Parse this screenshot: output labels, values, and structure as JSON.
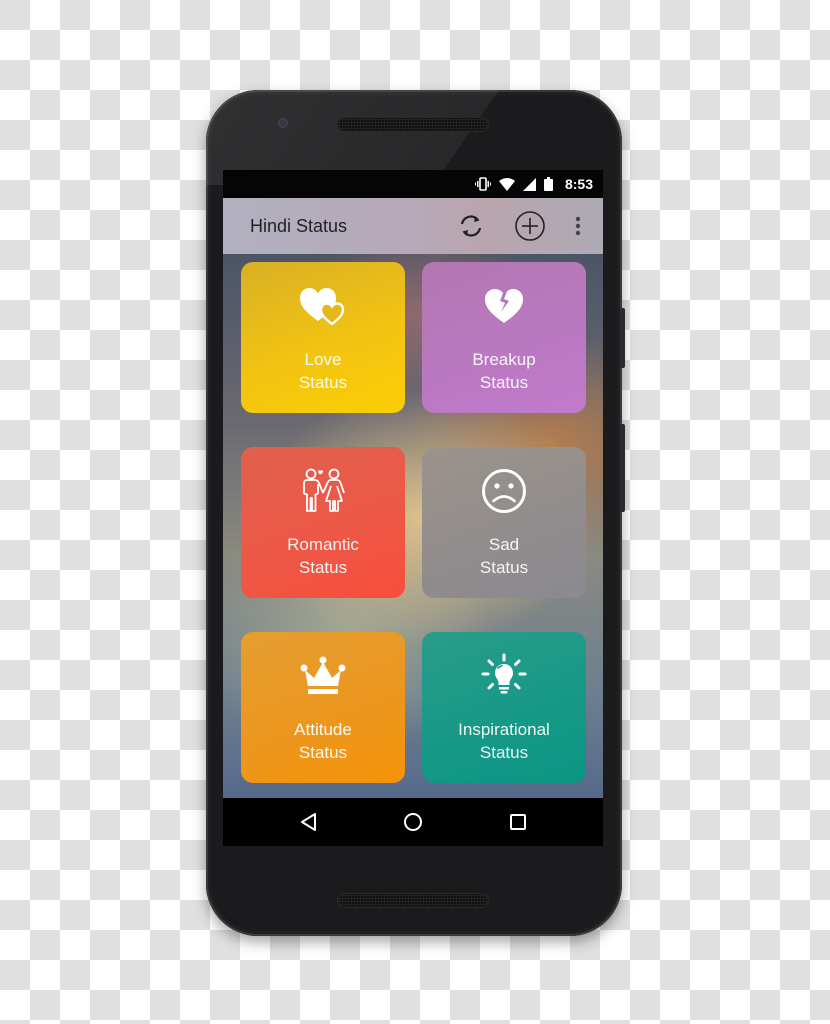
{
  "status_bar": {
    "time": "8:53",
    "icons": [
      "vibrate-icon",
      "wifi-icon",
      "signal-icon",
      "battery-icon"
    ]
  },
  "app_bar": {
    "title": "Hindi Status",
    "actions": [
      {
        "name": "refresh",
        "icon": "refresh-icon"
      },
      {
        "name": "add",
        "icon": "add-circle-icon"
      },
      {
        "name": "more",
        "icon": "more-vertical-icon"
      }
    ]
  },
  "categories": [
    {
      "line1": "Love",
      "line2": "Status",
      "icon": "two-hearts-icon",
      "color": "#f2c312"
    },
    {
      "line1": "Breakup",
      "line2": "Status",
      "icon": "broken-heart-icon",
      "color": "#bb78c2"
    },
    {
      "line1": "Romantic",
      "line2": "Status",
      "icon": "couple-icon",
      "color": "#ee5746"
    },
    {
      "line1": "Sad",
      "line2": "Status",
      "icon": "sad-face-icon",
      "color": "#918c8d"
    },
    {
      "line1": "Attitude",
      "line2": "Status",
      "icon": "crown-icon",
      "color": "#ec961d"
    },
    {
      "line1": "Inspirational",
      "line2": "Status",
      "icon": "lightbulb-icon",
      "color": "#169887"
    }
  ],
  "nav_bar": {
    "buttons": [
      "back",
      "home",
      "recents"
    ]
  }
}
